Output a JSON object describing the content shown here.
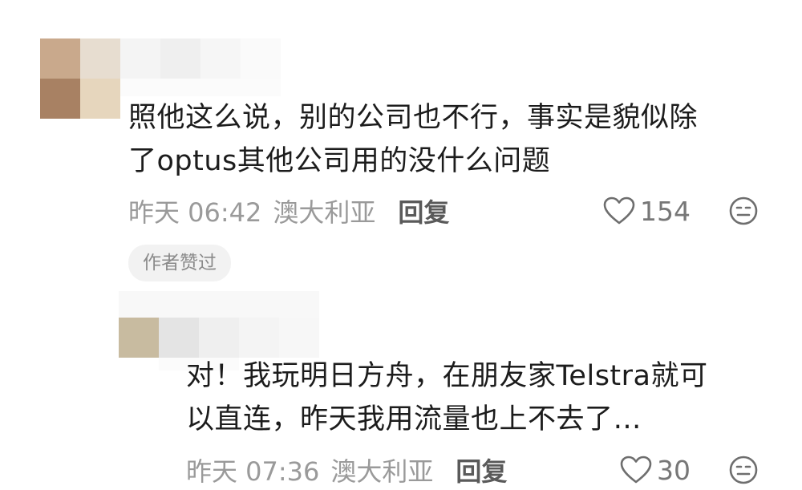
{
  "comments": [
    {
      "text_line1": "照他这么说，别的公司也不行，事实是貌似除",
      "text_line2": "了optus其他公司用的没什么问题",
      "time": "昨天 06:42",
      "location": "澳大利亚",
      "reply_label": "回复",
      "likes": "154",
      "badge": "作者赞过"
    },
    {
      "text_line1": "对！我玩明日方舟，在朋友家Telstra就可",
      "text_line2": "以直连，昨天我用流量也上不去了…",
      "time": "昨天 07:36",
      "location": "澳大利亚",
      "reply_label": "回复",
      "likes": "30"
    }
  ],
  "icons": {
    "like": "heart-outline-icon",
    "dislike": "meh-face-icon"
  }
}
